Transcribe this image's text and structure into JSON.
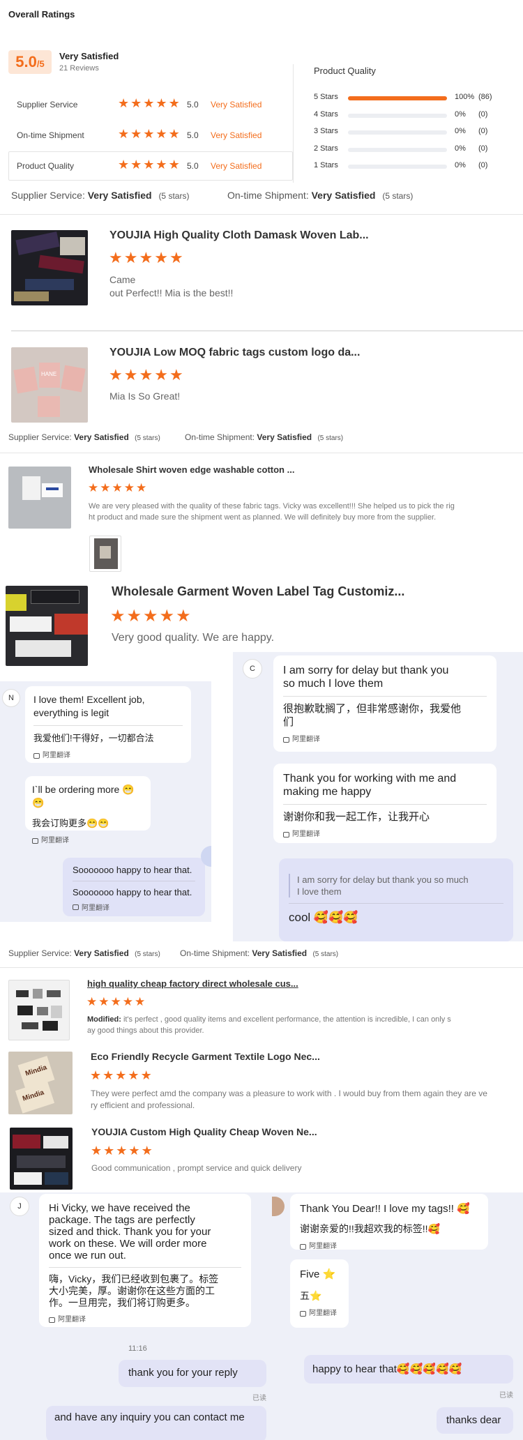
{
  "overall": {
    "heading": "Overall Ratings",
    "score": "5.0",
    "score_suffix": "/5",
    "label": "Very Satisfied",
    "reviews": "21 Reviews",
    "rows": [
      {
        "label": "Supplier Service",
        "value": "5.0",
        "status": "Very Satisfied"
      },
      {
        "label": "On-time Shipment",
        "value": "5.0",
        "status": "Very Satisfied"
      },
      {
        "label": "Product Quality",
        "value": "5.0",
        "status": "Very Satisfied"
      }
    ],
    "pq_title": "Product Quality",
    "breakdown": [
      {
        "label": "5 Stars",
        "pct": "100%",
        "count": "(86)",
        "fill": 1.0
      },
      {
        "label": "4 Stars",
        "pct": "0%",
        "count": "(0)",
        "fill": 0
      },
      {
        "label": "3 Stars",
        "pct": "0%",
        "count": "(0)",
        "fill": 0
      },
      {
        "label": "2 Stars",
        "pct": "0%",
        "count": "(0)",
        "fill": 0
      },
      {
        "label": "1 Stars",
        "pct": "0%",
        "count": "(0)",
        "fill": 0
      }
    ]
  },
  "summary1": {
    "ss_label": "Supplier Service:",
    "ss_value": "Very Satisfied",
    "ss_stars": "(5 stars)",
    "os_label": "On-time Shipment:",
    "os_value": "Very Satisfied",
    "os_stars": "(5 stars)"
  },
  "review1": {
    "title": "YOUJIA High Quality Cloth Damask Woven Lab...",
    "line1": "Came",
    "line2": "out Perfect!! Mia is the best!!"
  },
  "review2": {
    "title": "YOUJIA Low MOQ fabric tags custom logo da...",
    "text": "Mia Is So Great!",
    "thumb_text": "HANE"
  },
  "summary2": {
    "ss_label": "Supplier Service:",
    "ss_value": "Very Satisfied",
    "ss_stars": "(5 stars)",
    "os_label": "On-time Shipment:",
    "os_value": "Very Satisfied",
    "os_stars": "(5 stars)"
  },
  "review3": {
    "title": "Wholesale Shirt woven edge washable cotton ...",
    "line1": "We are very pleased with the quality of these fabric tags. Vicky was excellent!!! She helped us to pick the rig",
    "line2": "ht product and made sure the shipment went as planned. We will definitely buy more from the supplier."
  },
  "review4": {
    "title": "Wholesale Garment Woven Label Tag Customiz...",
    "text": "Very good quality. We are happy."
  },
  "chat1": {
    "avatar": "N",
    "b1_en_1": "I love them! Excellent job,",
    "b1_en_2": "everything is legit",
    "b1_zh": "我爱他们!干得好，一切都合法",
    "b2_en": "I`ll be ordering more 😁😁",
    "b2_zh": "我会订购更多😁😁",
    "b3_a": "Sooooooo happy to hear that.",
    "b3_b": "Sooooooo happy to hear that.",
    "translate": "阿里翻译"
  },
  "chat2": {
    "avatar": "C",
    "b1_en_1": "I am sorry for delay but thank you",
    "b1_en_2": "so much I love them",
    "b1_zh_1": "很抱歉耽搁了，但非常感谢你，我爱他",
    "b1_zh_2": "们",
    "b2_en_1": "Thank you for working with me and",
    "b2_en_2": "making me happy",
    "b2_zh": "谢谢你和我一起工作，让我开心",
    "b3_quote_1": "I am sorry for delay but thank you so much",
    "b3_quote_2": "I love them",
    "b3_text": "cool 🥰🥰🥰",
    "translate": "阿里翻译"
  },
  "summary3": {
    "ss_label": "Supplier Service:",
    "ss_value": "Very Satisfied",
    "ss_stars": "(5 stars)",
    "os_label": "On-time Shipment:",
    "os_value": "Very Satisfied",
    "os_stars": "(5 stars)"
  },
  "review5": {
    "title": "high quality cheap factory direct wholesale cus...",
    "prefix": "Modified:",
    "line1": " it's perfect , good quality items and excellent performance, the attention is incredible, I can only s",
    "line2": "ay good things about this provider."
  },
  "review6": {
    "title": "Eco Friendly Recycle Garment Textile Logo Nec...",
    "line1": "They were perfect amd the company was a pleasure to work with . I would buy from them again they are ve",
    "line2": "ry efficient and professional.",
    "thumb_text": "Mindia"
  },
  "review7": {
    "title": "YOUJIA Custom High Quality Cheap Woven Ne...",
    "text": "Good communication , prompt service and quick delivery"
  },
  "chat3": {
    "avatar": "J",
    "en_1": "Hi Vicky, we have received the",
    "en_2": "package. The tags are perfectly",
    "en_3": "sized and thick. Thank you for your",
    "en_4": "work on these. We will order more",
    "en_5": "once we run out.",
    "zh_1": "嗨，Vicky，我们已经收到包裹了。标签",
    "zh_2": "大小完美，厚。谢谢你在这些方面的工",
    "zh_3": "作。一旦用完，我们将订购更多。",
    "time": "11:16",
    "me1": "thank you for your reply",
    "read1": "已读",
    "me2": "and have any inquiry you can contact me",
    "translate": "阿里翻译"
  },
  "chat4": {
    "b1_en": "Thank You Dear!! I love my tags!! 🥰",
    "b1_zh": "谢谢亲爱的!!我超欢我的标签!!🥰",
    "b2_en": "Five ⭐",
    "b2_zh": "五⭐",
    "me1": "happy to hear that🥰🥰🥰🥰🥰",
    "read1": "已读",
    "me2": "thanks dear",
    "translate": "阿里翻译"
  }
}
